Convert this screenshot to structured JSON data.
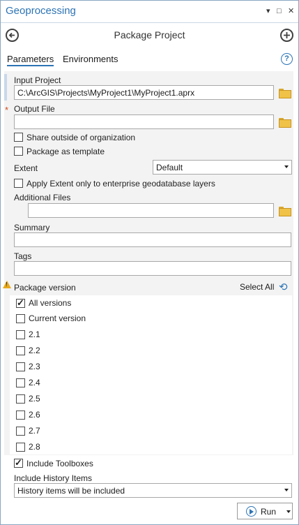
{
  "window": {
    "title": "Geoprocessing",
    "controls": [
      "▾",
      "□",
      "✕"
    ]
  },
  "header": {
    "title": "Package Project"
  },
  "tabs": [
    {
      "label": "Parameters",
      "active": true
    },
    {
      "label": "Environments",
      "active": false
    }
  ],
  "help_glyph": "?",
  "form": {
    "input_project": {
      "label": "Input Project",
      "value": "C:\\ArcGIS\\Projects\\MyProject1\\MyProject1.aprx"
    },
    "output_file": {
      "label": "Output File",
      "value": "",
      "required_marker": "*"
    },
    "share_outside": {
      "label": "Share outside of organization",
      "checked": false
    },
    "package_template": {
      "label": "Package as template",
      "checked": false
    },
    "extent": {
      "label": "Extent",
      "value": "Default"
    },
    "apply_extent": {
      "label": "Apply Extent only to enterprise geodatabase layers",
      "checked": false
    },
    "additional_files": {
      "label": "Additional Files",
      "value": ""
    },
    "summary": {
      "label": "Summary",
      "value": ""
    },
    "tags": {
      "label": "Tags",
      "value": ""
    },
    "package_version": {
      "label": "Package version",
      "select_all": "Select All",
      "warning_glyph": "!",
      "options": [
        {
          "label": "All versions",
          "checked": true
        },
        {
          "label": "Current version",
          "checked": false
        },
        {
          "label": "2.1",
          "checked": false
        },
        {
          "label": "2.2",
          "checked": false
        },
        {
          "label": "2.3",
          "checked": false
        },
        {
          "label": "2.4",
          "checked": false
        },
        {
          "label": "2.5",
          "checked": false
        },
        {
          "label": "2.6",
          "checked": false
        },
        {
          "label": "2.7",
          "checked": false
        },
        {
          "label": "2.8",
          "checked": false
        }
      ]
    },
    "include_toolboxes": {
      "label": "Include Toolboxes",
      "checked": true
    },
    "include_history": {
      "label": "Include History Items",
      "value": "History items will be included"
    }
  },
  "run_button": {
    "label": "Run"
  },
  "colors": {
    "accent": "#2c74b5",
    "panel": "#f3f3f3",
    "required": "#d04a1a",
    "warning": "#e8a91a"
  }
}
